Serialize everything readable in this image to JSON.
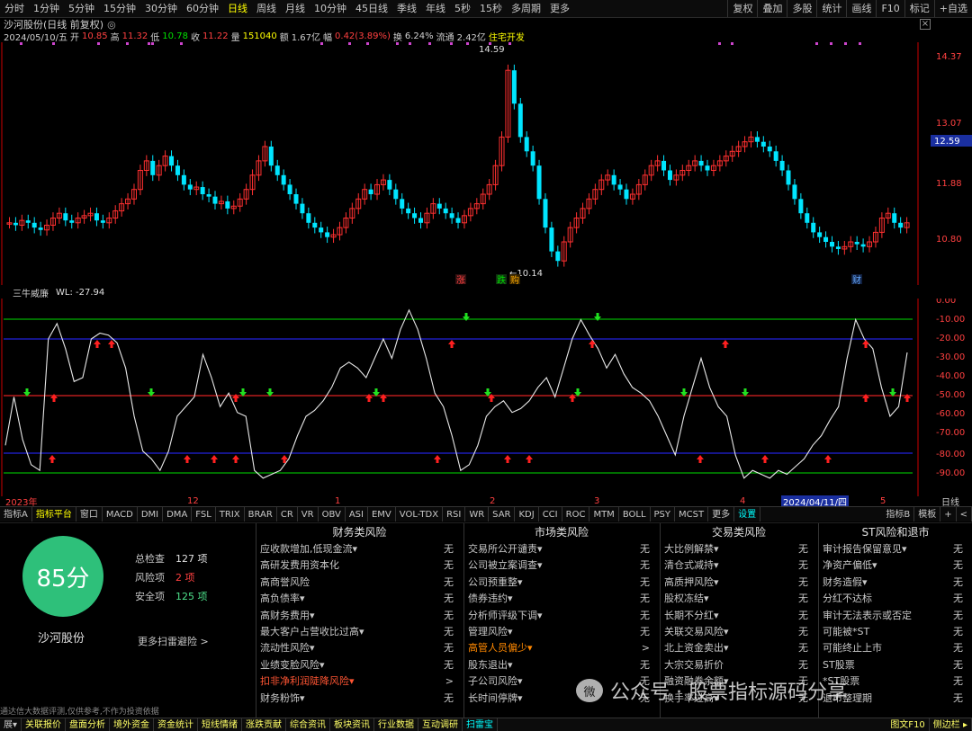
{
  "toolbar": {
    "items": [
      "分时",
      "1分钟",
      "5分钟",
      "15分钟",
      "30分钟",
      "60分钟",
      "日线",
      "周线",
      "月线",
      "10分钟",
      "45日线",
      "季线",
      "年线",
      "5秒",
      "15秒",
      "多周期",
      "更多"
    ],
    "active": "日线",
    "right": [
      "复权",
      "叠加",
      "多股",
      "统计",
      "画线",
      "F10",
      "标记",
      "+自选"
    ]
  },
  "info": {
    "title": "沙河股份(日线 前复权)",
    "badge": "◎",
    "close_box": "×"
  },
  "quote": {
    "date": "2024/05/10/五",
    "open_label": "开",
    "open": "10.85",
    "high_label": "高",
    "high": "11.32",
    "low_label": "低",
    "low": "10.78",
    "close_label": "收",
    "close": "11.22",
    "vol_label": "量",
    "vol": "151040",
    "amt_label": "额",
    "amt": "1.67亿",
    "chg_label": "幅",
    "chg": "0.42(3.89%)",
    "turn_label": "换",
    "turn": "6.24%",
    "float_label": "流通",
    "float": "2.42亿",
    "note": "住宅开发"
  },
  "main_axis": [
    "14.37",
    "13.07",
    "11.88",
    "10.80"
  ],
  "current_price": "12.59",
  "peak_label": "14.59",
  "trough_label": "←10.14",
  "markers": {
    "zhang": "涨",
    "die": "跌",
    "gou": "购",
    "cai": "财"
  },
  "indicator": {
    "name": "三牛威廉",
    "value": "WL: -27.94",
    "axis": [
      "0.00",
      "-10.00",
      "-20.00",
      "-30.00",
      "-40.00",
      "-50.00",
      "-60.00",
      "-70.00",
      "-80.00",
      "-90.00"
    ]
  },
  "dates": {
    "year": "2023年",
    "m12": "12",
    "m1": "1",
    "m2": "2",
    "m3": "3",
    "m4": "4",
    "sel": "2024/04/11/四",
    "m5": "5",
    "unit": "日线"
  },
  "tabs": [
    "指标A",
    "指标平台",
    "窗口",
    "MACD",
    "DMI",
    "DMA",
    "FSL",
    "TRIX",
    "BRAR",
    "CR",
    "VR",
    "OBV",
    "ASI",
    "EMV",
    "VOL-TDX",
    "RSI",
    "WR",
    "SAR",
    "KDJ",
    "CCI",
    "ROC",
    "MTM",
    "BOLL",
    "PSY",
    "MCST",
    "更多",
    "设置"
  ],
  "tabs_right": [
    "指标B",
    "模板",
    "+",
    "<"
  ],
  "panel": {
    "score": "85分",
    "company": "沙河股份",
    "total_label": "总检查",
    "total": "127 项",
    "risk_label": "风险项",
    "risk": "2 项",
    "safe_label": "安全项",
    "safe": "125 项",
    "more": "更多扫雷避险 >",
    "columns": [
      {
        "title": "财务类风险",
        "rows": [
          [
            "应收款增加,低现金流▾",
            "无"
          ],
          [
            "高研发费用资本化",
            "无"
          ],
          [
            "高商誉风险",
            "无"
          ],
          [
            "高负债率▾",
            "无"
          ],
          [
            "高财务费用▾",
            "无"
          ],
          [
            "最大客户占营收比过高▾",
            "无"
          ],
          [
            "流动性风险▾",
            "无"
          ],
          [
            "业绩变脸风险▾",
            "无"
          ],
          [
            "扣非净利润陡降风险▾",
            ">"
          ],
          [
            "财务粉饰▾",
            "无"
          ]
        ]
      },
      {
        "title": "市场类风险",
        "rows": [
          [
            "交易所公开谴责▾",
            "无"
          ],
          [
            "公司被立案调查▾",
            "无"
          ],
          [
            "公司预重整▾",
            "无"
          ],
          [
            "债券违约▾",
            "无"
          ],
          [
            "分析师评级下调▾",
            "无"
          ],
          [
            "管理风险▾",
            "无"
          ],
          [
            "高管人员偏少▾",
            ">"
          ],
          [
            "股东退出▾",
            "无"
          ],
          [
            "子公司风险▾",
            "无"
          ],
          [
            "长时间停牌▾",
            "无"
          ]
        ]
      },
      {
        "title": "交易类风险",
        "rows": [
          [
            "大比例解禁▾",
            "无"
          ],
          [
            "清仓式减持▾",
            "无"
          ],
          [
            "高质押风险▾",
            "无"
          ],
          [
            "股权冻结▾",
            "无"
          ],
          [
            "长期不分红▾",
            "无"
          ],
          [
            "关联交易风险▾",
            "无"
          ],
          [
            "北上资金卖出▾",
            "无"
          ],
          [
            "大宗交易折价",
            "无"
          ],
          [
            "融资融券余额▾",
            "无"
          ],
          [
            "换手率过高▾",
            "无"
          ]
        ]
      },
      {
        "title": "ST风险和退市",
        "rows": [
          [
            "审计报告保留意见▾",
            "无"
          ],
          [
            "净资产偏低▾",
            "无"
          ],
          [
            "财务造假▾",
            "无"
          ],
          [
            "分红不达标",
            "无"
          ],
          [
            "审计无法表示或否定",
            "无"
          ],
          [
            "可能被*ST",
            "无"
          ],
          [
            "可能终止上市",
            "无"
          ],
          [
            "ST股票",
            "无"
          ],
          [
            "*ST股票",
            "无"
          ],
          [
            "退市整理期",
            "无"
          ]
        ]
      }
    ],
    "disclaimer": "通达信大数据评测,仅供参考,不作为投资依据",
    "watermark": "公众号 · 股票指标源码分享",
    "wm_icon": "微"
  },
  "bottom": [
    "展▾",
    "关联报价",
    "盘面分析",
    "境外资金",
    "资金统计",
    "短线情绪",
    "涨跌贡献",
    "综合资讯",
    "板块资讯",
    "行业数据",
    "互动调研",
    "扫雷宝"
  ],
  "bottom_right": [
    "图文F10",
    "侧边栏 ▸"
  ]
}
